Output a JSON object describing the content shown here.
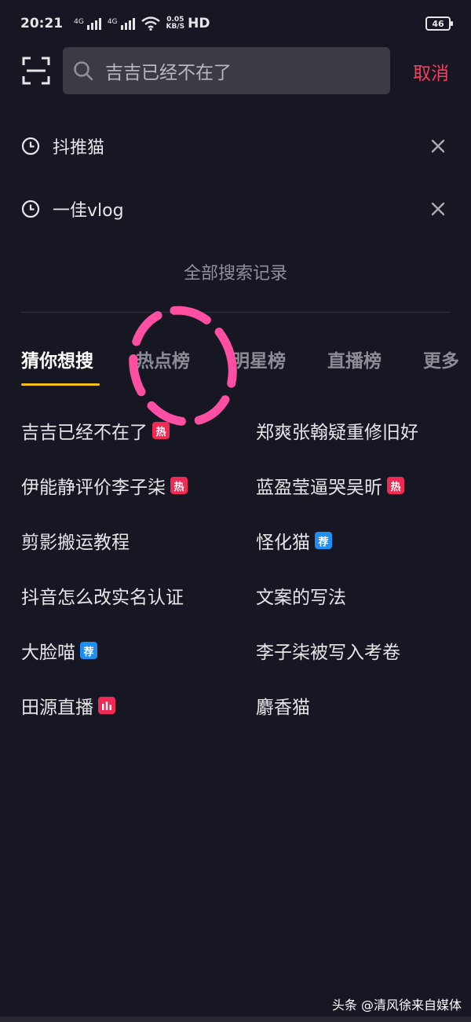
{
  "status": {
    "time": "20:21",
    "sim1": "4G",
    "sim2": "4G",
    "net_speed": "0.05",
    "net_unit": "KB/S",
    "hd": "HD",
    "battery": "46"
  },
  "search": {
    "query": "吉吉已经不在了",
    "cancel_label": "取消"
  },
  "history": [
    {
      "label": "抖推猫"
    },
    {
      "label": "一佳vlog"
    }
  ],
  "all_history_label": "全部搜索记录",
  "tabs": [
    {
      "label": "猜你想搜",
      "active": true
    },
    {
      "label": "热点榜",
      "active": false
    },
    {
      "label": "明星榜",
      "active": false
    },
    {
      "label": "直播榜",
      "active": false
    },
    {
      "label": "更多",
      "active": false
    }
  ],
  "suggestions": [
    {
      "text": "吉吉已经不在了",
      "badge": "热",
      "badge_type": "hot"
    },
    {
      "text": "郑爽张翰疑重修旧好",
      "badge": "",
      "badge_type": ""
    },
    {
      "text": "伊能静评价李子柒",
      "badge": "热",
      "badge_type": "hot"
    },
    {
      "text": "蓝盈莹逼哭吴昕",
      "badge": "热",
      "badge_type": "hot"
    },
    {
      "text": "剪影搬运教程",
      "badge": "",
      "badge_type": ""
    },
    {
      "text": "怪化猫",
      "badge": "荐",
      "badge_type": "rec"
    },
    {
      "text": "抖音怎么改实名认证",
      "badge": "",
      "badge_type": ""
    },
    {
      "text": "文案的写法",
      "badge": "",
      "badge_type": ""
    },
    {
      "text": "大脸喵",
      "badge": "荐",
      "badge_type": "rec"
    },
    {
      "text": "李子柒被写入考卷",
      "badge": "",
      "badge_type": ""
    },
    {
      "text": "田源直播",
      "badge": "",
      "badge_type": "live"
    },
    {
      "text": "麝香猫",
      "badge": "",
      "badge_type": ""
    }
  ],
  "watermark": "头条 @清风徐来自媒体",
  "colors": {
    "background": "#161722",
    "accent_cancel": "#ff3b5c",
    "tab_indicator": "#f5c01b",
    "badge_hot": "#f02a55",
    "badge_rec": "#1e8ef0",
    "annotation_circle": "#ff4fa3"
  }
}
